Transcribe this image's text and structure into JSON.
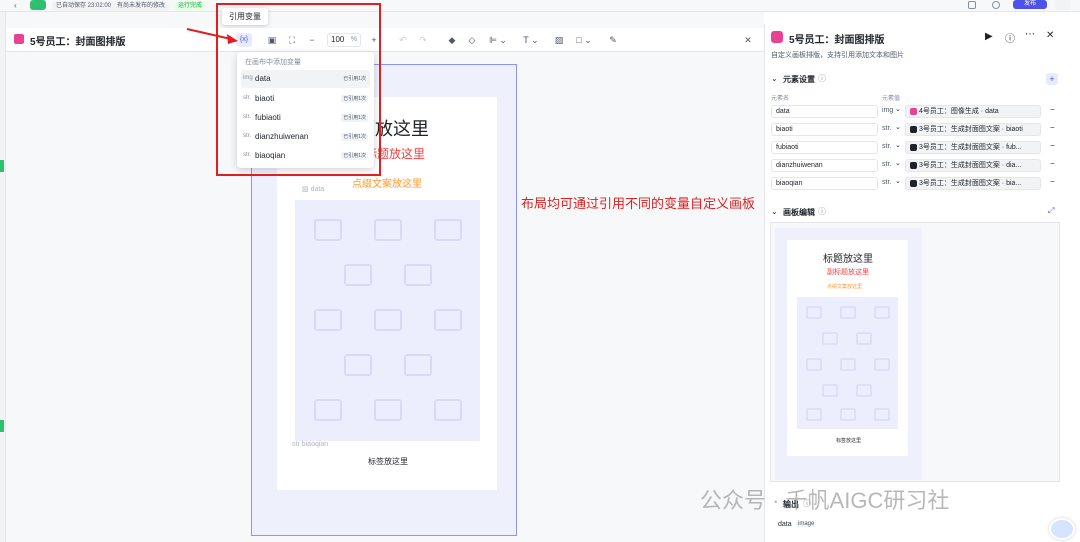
{
  "topbar": {
    "autosave": "已自动保存 23:02:00",
    "unpublished": "有尚未发布的修改",
    "run_status": "运行完成",
    "publish_label": "发布"
  },
  "editor": {
    "title": "5号员工：封面图排版",
    "zoom_value": "100",
    "zoom_unit": "%",
    "variable_button": "{x}"
  },
  "tooltip": {
    "text": "引用变量"
  },
  "dropdown": {
    "header": "在画布中添加变量",
    "items": [
      {
        "type": "img",
        "name": "data",
        "badge": "已引用1次"
      },
      {
        "type": "str.",
        "name": "biaoti",
        "badge": "已引用1次"
      },
      {
        "type": "str.",
        "name": "fubiaoti",
        "badge": "已引用1次"
      },
      {
        "type": "str.",
        "name": "dianzhuiwenan",
        "badge": "已引用1次"
      },
      {
        "type": "str.",
        "name": "biaoqian",
        "badge": "已引用1次"
      }
    ]
  },
  "canvas": {
    "title_text": "题放这里",
    "subtitle_text": "标题放这里",
    "accent_text": "点缀文案放这里",
    "image_label": "data",
    "tag_var_label": "biaoqian",
    "tag_text": "标签放这里"
  },
  "annotation": {
    "text": "布局均可通过引用不同的变量自定义画板"
  },
  "panel": {
    "title": "5号员工：封面图排版",
    "description": "自定义画板排版，支持引用添加文本和图片",
    "section_elements": "元素设置",
    "col_name": "元素名",
    "col_value": "元素值",
    "rows": [
      {
        "name": "data",
        "type": "img",
        "value": "4号员工：图像生成 · data"
      },
      {
        "name": "biaoti",
        "type": "str.",
        "value": "3号员工：生成封面图文案 · biaoti"
      },
      {
        "name": "fubiaoti",
        "type": "str.",
        "value": "3号员工：生成封面图文案 · fub..."
      },
      {
        "name": "dianzhuiwenan",
        "type": "str.",
        "value": "3号员工：生成封面图文案 · dia..."
      },
      {
        "name": "biaoqian",
        "type": "str.",
        "value": "3号员工：生成封面图文案 · bia..."
      }
    ],
    "section_board": "画板编辑",
    "section_output": "输出",
    "output_name": "data",
    "output_type": "image"
  },
  "preview": {
    "title_text": "标题放这里",
    "subtitle_text": "副标题放这里",
    "accent_text": "点缀文案放这里",
    "tag_text": "标签放这里"
  },
  "watermark": {
    "text": "公众号 · 千帆AIGC研习社"
  },
  "colors": {
    "accent": "#4d53e8",
    "red_annotation": "#e02020",
    "subtitle_red": "#f53f3f",
    "accent_orange": "#ff9a2e",
    "artboard_border": "#8c94f5",
    "brand_pink": "#e84393"
  }
}
